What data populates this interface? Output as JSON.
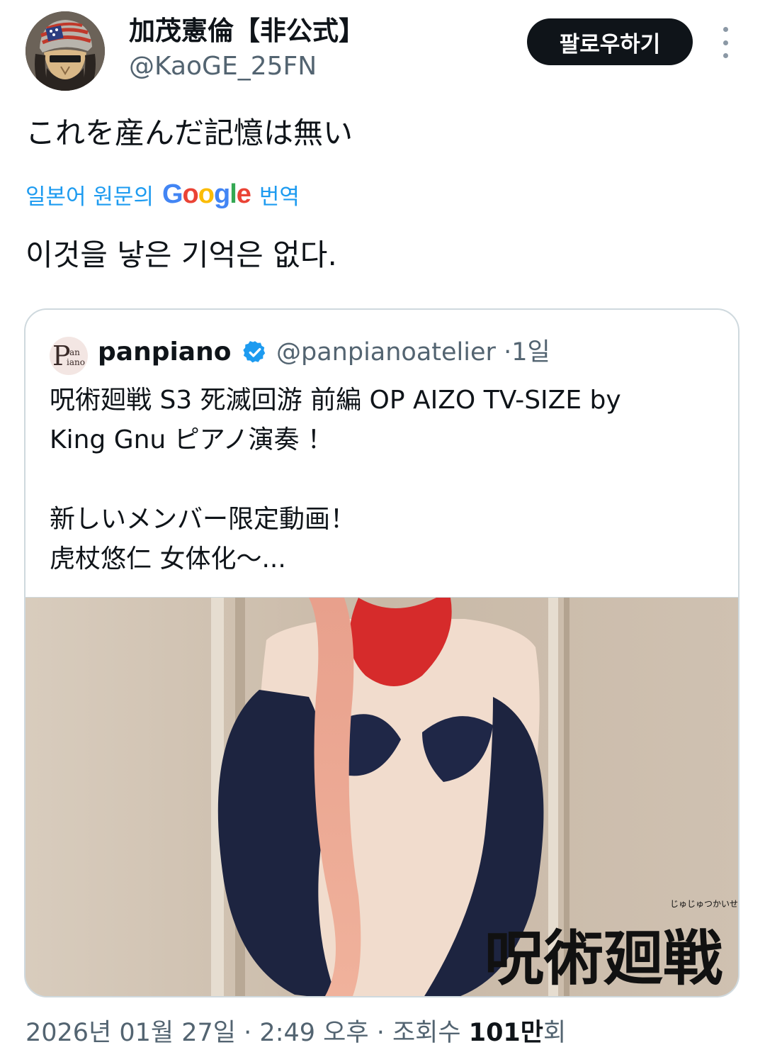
{
  "tweet": {
    "author": {
      "name": "加茂憲倫【非公式】",
      "handle": "@KaoGE_25FN"
    },
    "follow_label": "팔로우하기",
    "text": "これを産んだ記憶は無い",
    "translation": {
      "prefix": "일본어 원문의",
      "provider_letters": [
        "G",
        "o",
        "o",
        "g",
        "l",
        "e"
      ],
      "suffix": "번역",
      "text": "이것을 낳은 기억은 없다."
    },
    "quoted": {
      "avatar_text": "P",
      "avatar_sub1": "an",
      "avatar_sub2": "iano",
      "name": "panpiano",
      "handle": "@panpianoatelier",
      "separator": "·",
      "time": "1일",
      "lines": [
        "呪術廻戦 S3 死滅回游 前編 OP AIZO TV-SIZE by",
        "King Gnu ピアノ演奏 ！",
        "",
        "新しいメンバー限定動画！",
        "虎杖悠仁 女体化〜..."
      ],
      "image_watermark": "呪術廻戦",
      "image_watermark_ruby": "じゅじゅつかいせん"
    },
    "footer": {
      "date": "2026년 01월 27일",
      "time": "2:49 오후",
      "views_label": "조회수",
      "views_value": "101만",
      "views_suffix": "회",
      "sep": "·"
    }
  },
  "colors": {
    "text_primary": "#0f1419",
    "text_secondary": "#536471",
    "link": "#1d9bf0",
    "verified": "#1d9bf0",
    "follow_bg": "#0f1419"
  },
  "icons": {
    "more": "more-vertical-icon",
    "verified": "verified-badge-icon"
  }
}
